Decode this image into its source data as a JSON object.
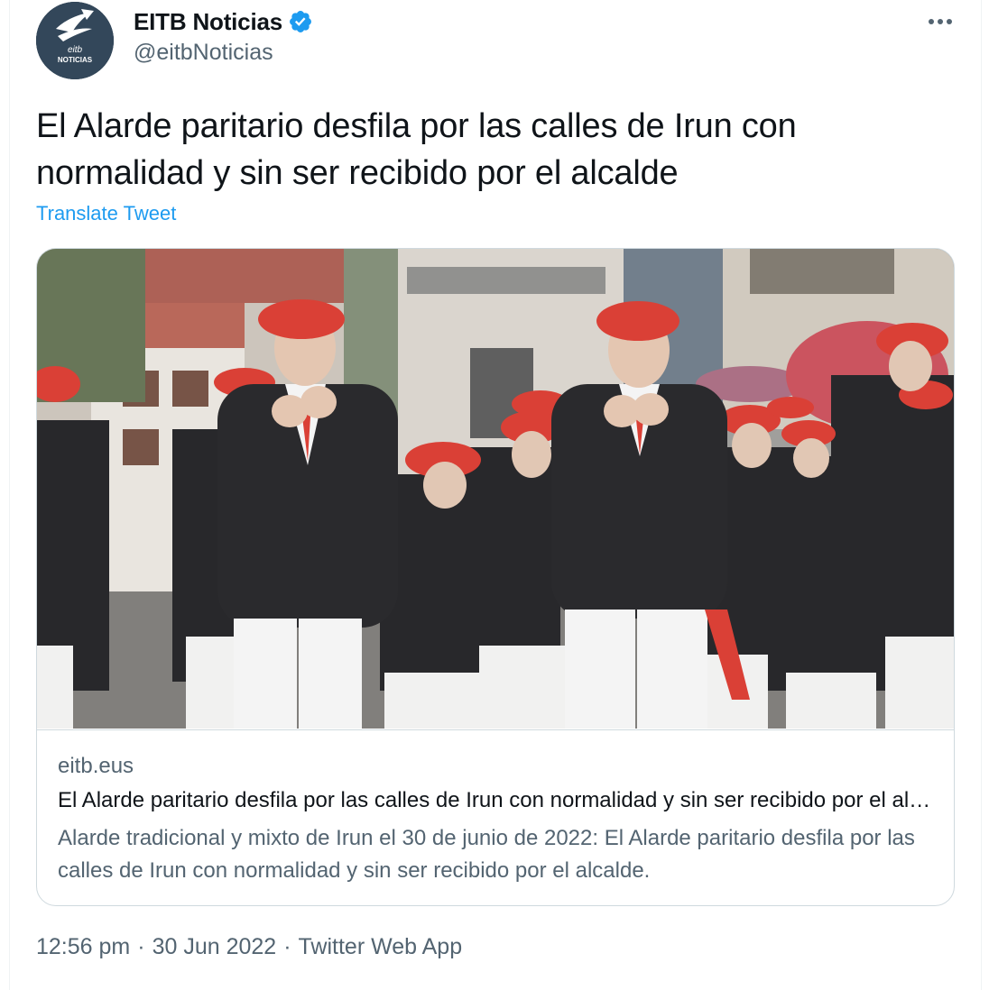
{
  "author": {
    "display_name": "EITB Noticias",
    "handle": "@eitbNoticias",
    "verified": true,
    "avatar_text_top": "eitb",
    "avatar_text_bottom": "NOTICIAS"
  },
  "tweet": {
    "text": "El Alarde paritario desfila por las calles de Irun con normalidad y sin ser recibido por el alcalde",
    "translate_label": "Translate Tweet"
  },
  "card": {
    "domain": "eitb.eus",
    "title": "El Alarde paritario desfila por las calles de Irun con normalidad y sin ser recibido por el alcalde",
    "description": "Alarde tradicional y mixto de Irun el 30 de junio de 2022: El Alarde paritario desfila por las calles de Irun con normalidad y sin ser recibido por el alcalde."
  },
  "meta": {
    "time": "12:56 pm",
    "date": "30 Jun 2022",
    "separator": "·",
    "source": "Twitter Web App"
  },
  "colors": {
    "link": "#1d9bf0",
    "secondary_text": "#536471",
    "primary_text": "#0f1419",
    "border": "#cfd9de",
    "beret_red": "#d8352a"
  },
  "icons": {
    "verified": "verified-badge-icon",
    "more": "more-horizontal-icon"
  }
}
